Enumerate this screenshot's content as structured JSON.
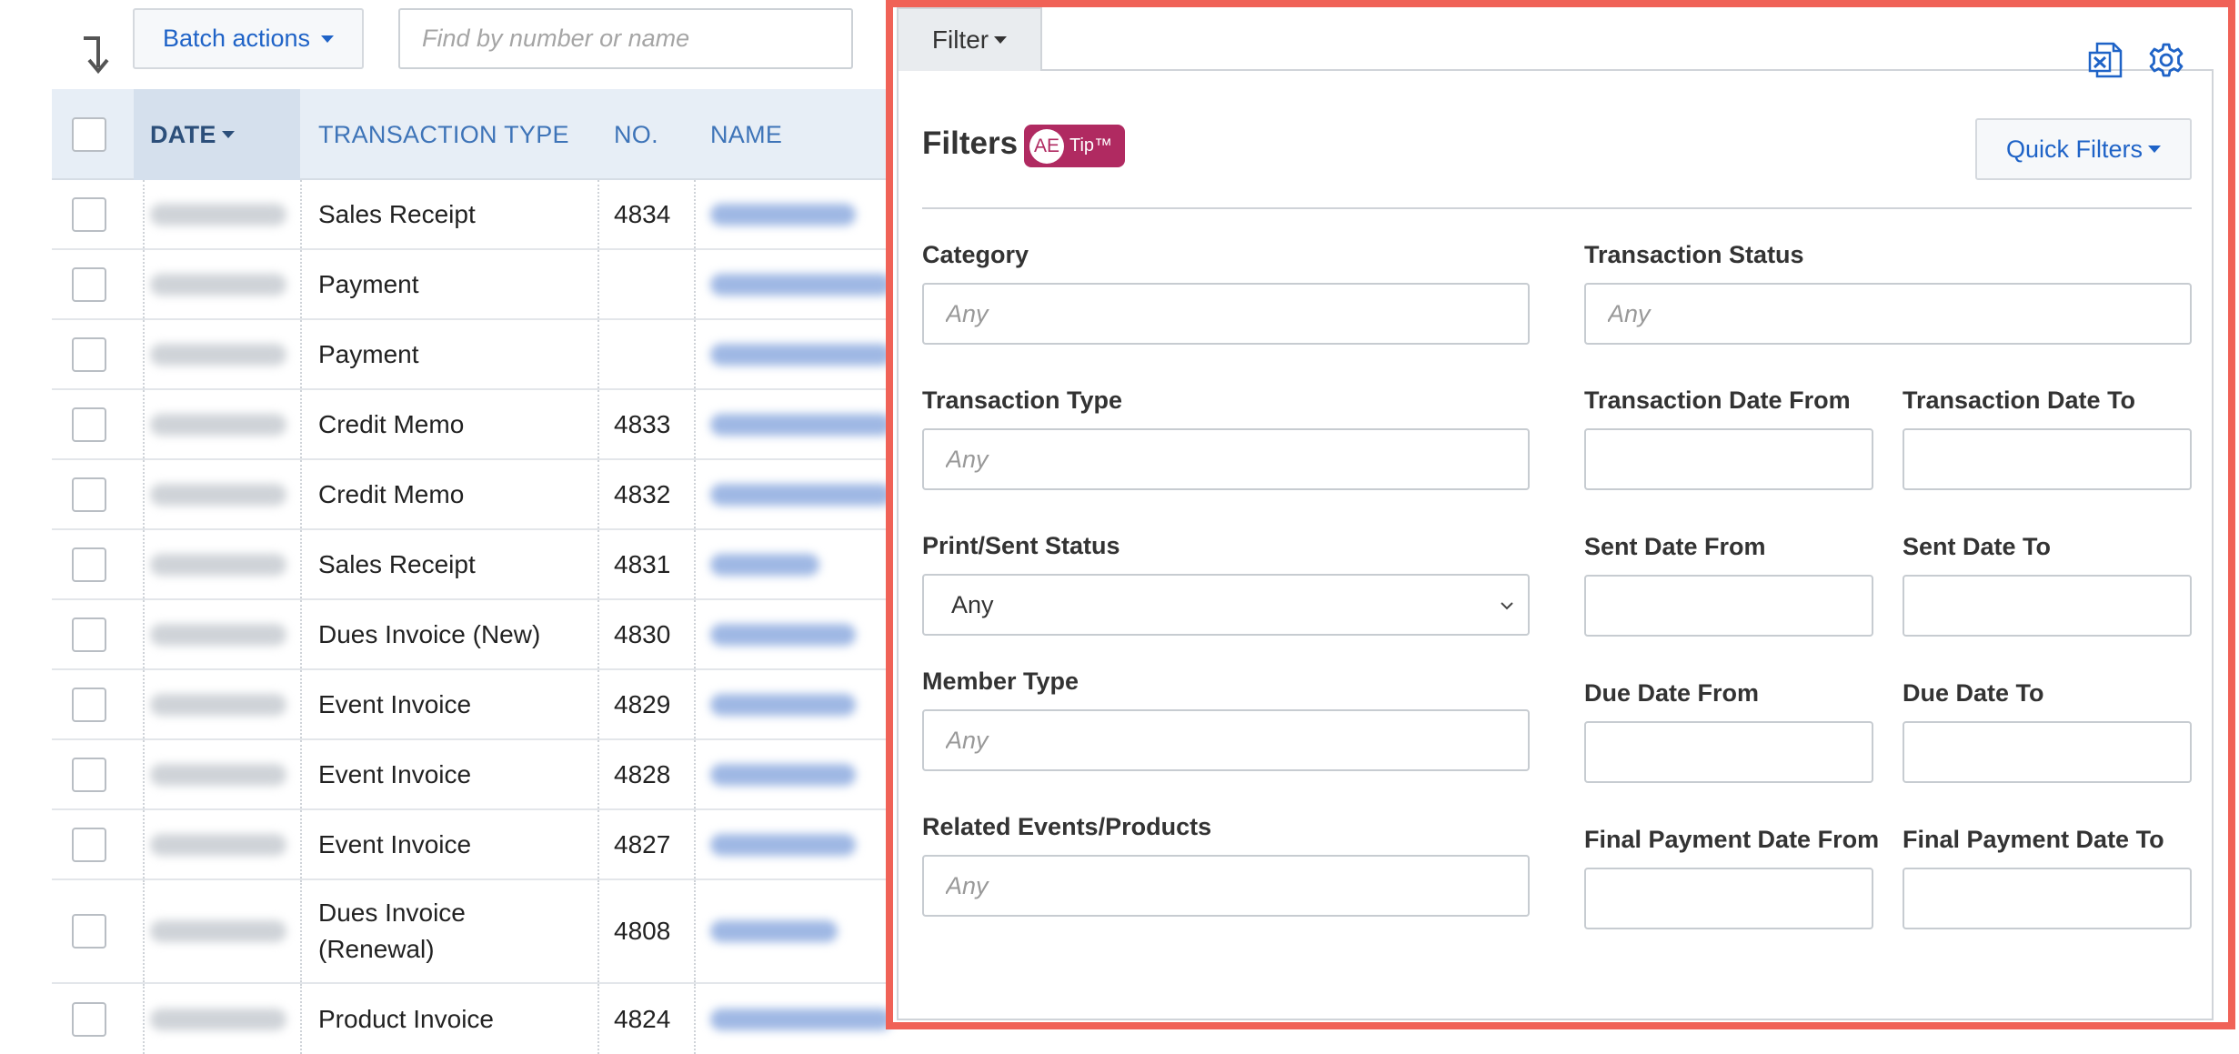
{
  "toolbar": {
    "batch_label": "Batch actions",
    "search_placeholder": "Find by number or name"
  },
  "table": {
    "columns": {
      "date": "DATE",
      "type": "TRANSACTION TYPE",
      "number": "NO.",
      "name": "NAME"
    },
    "rows": [
      {
        "type": "Sales Receipt",
        "number": "4834"
      },
      {
        "type": "Payment",
        "number": ""
      },
      {
        "type": "Payment",
        "number": ""
      },
      {
        "type": "Credit Memo",
        "number": "4833"
      },
      {
        "type": "Credit Memo",
        "number": "4832"
      },
      {
        "type": "Sales Receipt",
        "number": "4831"
      },
      {
        "type": "Dues Invoice (New)",
        "number": "4830"
      },
      {
        "type": "Event Invoice",
        "number": "4829"
      },
      {
        "type": "Event Invoice",
        "number": "4828"
      },
      {
        "type": "Event Invoice",
        "number": "4827"
      },
      {
        "type_line1": "Dues Invoice",
        "type_line2": "(Renewal)",
        "number": "4808"
      },
      {
        "type": "Product Invoice",
        "number": "4824"
      }
    ]
  },
  "filter_panel": {
    "tab_label": "Filter",
    "title": "Filters",
    "badge_ae": "AE",
    "badge_tip": "Tip™",
    "quick_filters_label": "Quick Filters",
    "fields": {
      "category": {
        "label": "Category",
        "placeholder": "Any"
      },
      "transaction_status": {
        "label": "Transaction Status",
        "placeholder": "Any"
      },
      "transaction_type": {
        "label": "Transaction Type",
        "placeholder": "Any"
      },
      "transaction_date_from": {
        "label": "Transaction Date From"
      },
      "transaction_date_to": {
        "label": "Transaction Date To"
      },
      "print_sent_status": {
        "label": "Print/Sent Status",
        "selected": "Any"
      },
      "sent_date_from": {
        "label": "Sent Date From"
      },
      "sent_date_to": {
        "label": "Sent Date To"
      },
      "member_type": {
        "label": "Member Type",
        "placeholder": "Any"
      },
      "due_date_from": {
        "label": "Due Date From"
      },
      "due_date_to": {
        "label": "Due Date To"
      },
      "related_events": {
        "label": "Related Events/Products",
        "placeholder": "Any"
      },
      "final_payment_from": {
        "label": "Final Payment Date From"
      },
      "final_payment_to": {
        "label": "Final Payment Date To"
      }
    }
  },
  "colors": {
    "accent": "#1f63c7",
    "highlight_border": "#f06257",
    "badge": "#b02a61"
  },
  "icons": [
    "sort-arrow-icon",
    "excel-export-icon",
    "settings-gear-icon",
    "chevron-down-icon"
  ]
}
